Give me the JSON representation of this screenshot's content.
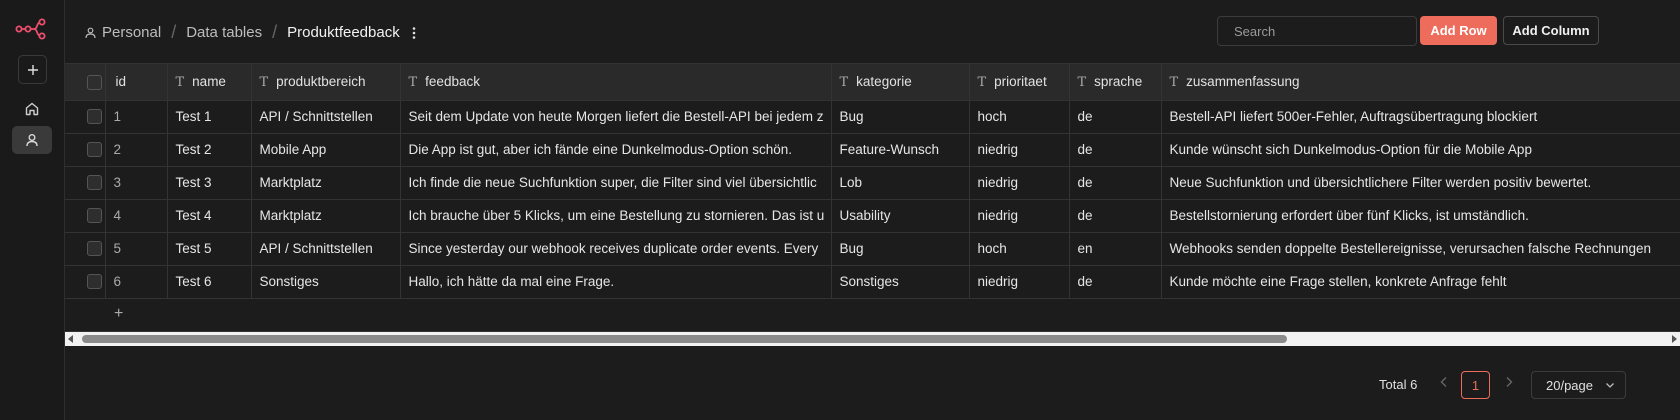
{
  "breadcrumb": {
    "home": "Personal",
    "section": "Data tables",
    "current": "Produktfeedback"
  },
  "search": {
    "placeholder": "Search"
  },
  "actions": {
    "add_row": "Add Row",
    "add_column": "Add Column"
  },
  "colors": {
    "accent": "#ee6c5b",
    "background": "#1c1c1c",
    "header_bg": "#2a2a2a"
  },
  "icons": [
    "logo-icon",
    "plus-icon",
    "home-icon",
    "user-icon",
    "person-icon",
    "kebab-icon",
    "search-icon",
    "info-icon",
    "text-type-icon",
    "chevron-down-icon"
  ],
  "table": {
    "columns": [
      "id",
      "name",
      "produktbereich",
      "feedback",
      "kategorie",
      "prioritaet",
      "sprache",
      "zusammenfassung"
    ],
    "column_type_glyph": "T",
    "rows": [
      [
        "1",
        "Test 1",
        "API / Schnittstellen",
        "Seit dem Update von heute Morgen liefert die Bestell-API bei jedem z",
        "Bug",
        "hoch",
        "de",
        "Bestell-API liefert 500er-Fehler, Auftragsübertragung blockiert"
      ],
      [
        "2",
        "Test 2",
        "Mobile App",
        "Die App ist gut, aber ich fände eine Dunkelmodus-Option schön.",
        "Feature-Wunsch",
        "niedrig",
        "de",
        "Kunde wünscht sich Dunkelmodus-Option für die Mobile App"
      ],
      [
        "3",
        "Test 3",
        "Marktplatz",
        "Ich finde die neue Suchfunktion super, die Filter sind viel übersichtlic",
        "Lob",
        "niedrig",
        "de",
        "Neue Suchfunktion und übersichtlichere Filter werden positiv bewertet."
      ],
      [
        "4",
        "Test 4",
        "Marktplatz",
        "Ich brauche über 5 Klicks, um eine Bestellung zu stornieren. Das ist u",
        "Usability",
        "niedrig",
        "de",
        "Bestellstornierung erfordert über fünf Klicks, ist umständlich."
      ],
      [
        "5",
        "Test 5",
        "API / Schnittstellen",
        "Since yesterday our webhook receives duplicate order events. Every",
        "Bug",
        "hoch",
        "en",
        "Webhooks senden doppelte Bestellereignisse, verursachen falsche Rechnungen"
      ],
      [
        "6",
        "Test 6",
        "Sonstiges",
        "Hallo, ich hätte da mal eine Frage.",
        "Sonstiges",
        "niedrig",
        "de",
        "Kunde möchte eine Frage stellen, konkrete Anfrage fehlt"
      ]
    ],
    "add_row_glyph": "+"
  },
  "footer": {
    "total": "Total 6",
    "current_page": "1",
    "per_page": "20/page"
  }
}
